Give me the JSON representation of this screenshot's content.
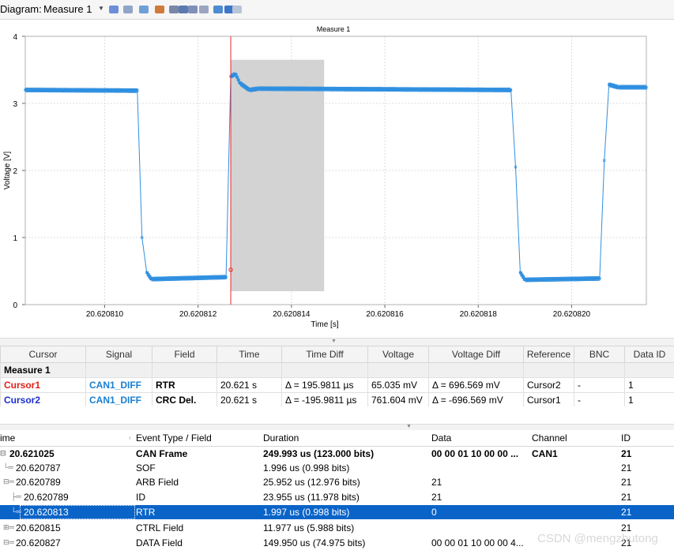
{
  "toolbar": {
    "diagram_label": "Diagram:",
    "diagram_value": "Measure 1"
  },
  "chart_data": {
    "type": "line",
    "title": "Measure 1",
    "xlabel": "Time [s]",
    "ylabel": "Voltage [V]",
    "x_ticks": [
      "20.620810",
      "20.620812",
      "20.620814",
      "20.620816",
      "20.620818",
      "20.620820"
    ],
    "y_ticks": [
      "0",
      "1",
      "2",
      "3",
      "4"
    ],
    "xlim": [
      20.6208083,
      20.6208216
    ],
    "ylim": [
      0,
      4
    ],
    "grid": true,
    "series_color": "#2f8fe0",
    "cursor_color": "#e8282a",
    "selection_range_x": [
      20.6208127,
      20.6208147
    ],
    "cursor1_x": 20.6208127,
    "series": [
      {
        "values_x": [
          20.6208083,
          20.6208107,
          20.6208108,
          20.6208109,
          20.620811,
          20.6208126,
          20.6208127,
          20.6208128,
          20.6208129,
          20.6208131,
          20.6208133,
          20.6208187,
          20.6208188,
          20.6208189,
          20.620819,
          20.6208206,
          20.6208207,
          20.6208208,
          20.620821,
          20.6208216
        ],
        "values_y": [
          3.2,
          3.19,
          1.0,
          0.48,
          0.38,
          0.41,
          3.4,
          3.44,
          3.3,
          3.2,
          3.22,
          3.2,
          2.05,
          0.48,
          0.37,
          0.39,
          2.15,
          3.28,
          3.24,
          3.24
        ]
      }
    ]
  },
  "cursor_table": {
    "headers": [
      "Cursor",
      "Signal",
      "Field",
      "Time",
      "Time Diff",
      "Voltage",
      "Voltage Diff",
      "Reference",
      "BNC",
      "Data ID"
    ],
    "group": "Measure 1",
    "rows": [
      [
        "Cursor1",
        "CAN1_DIFF",
        "RTR",
        "20.621 s",
        "Δ = 195.9811 µs",
        "65.035 mV",
        "Δ = 696.569 mV",
        "Cursor2",
        "-",
        "1"
      ],
      [
        "Cursor2",
        "CAN1_DIFF",
        "CRC Del.",
        "20.621 s",
        "Δ = -195.9811 µs",
        "761.604 mV",
        "Δ = -696.569 mV",
        "Cursor1",
        "-",
        "1"
      ]
    ]
  },
  "event_table": {
    "headers": [
      "ime",
      "Event Type / Field",
      "Duration",
      "Data",
      "Channel",
      "ID"
    ],
    "rows": [
      [
        "20.621025",
        "CAN Frame",
        "249.993 us (123.000 bits)",
        "00 00 01 10 00 00 ...",
        "CAN1",
        "21"
      ],
      [
        "20.620787",
        "SOF",
        "1.996 us (0.998 bits)",
        "",
        "",
        "21"
      ],
      [
        "20.620789",
        "ARB Field",
        "25.952 us (12.976 bits)",
        "21",
        "",
        "21"
      ],
      [
        "20.620789",
        "ID",
        "23.955 us (11.978 bits)",
        "21",
        "",
        "21"
      ],
      [
        "20.620813",
        "RTR",
        "1.997 us (0.998 bits)",
        "0",
        "",
        "21"
      ],
      [
        "20.620815",
        "CTRL Field",
        "11.977 us (5.988 bits)",
        "",
        "",
        "21"
      ],
      [
        "20.620827",
        "DATA Field",
        "149.950 us (74.975 bits)",
        "00 00 01 10 00 00 4...",
        "",
        "21"
      ]
    ]
  },
  "watermark": "CSDN @mengzhutong"
}
